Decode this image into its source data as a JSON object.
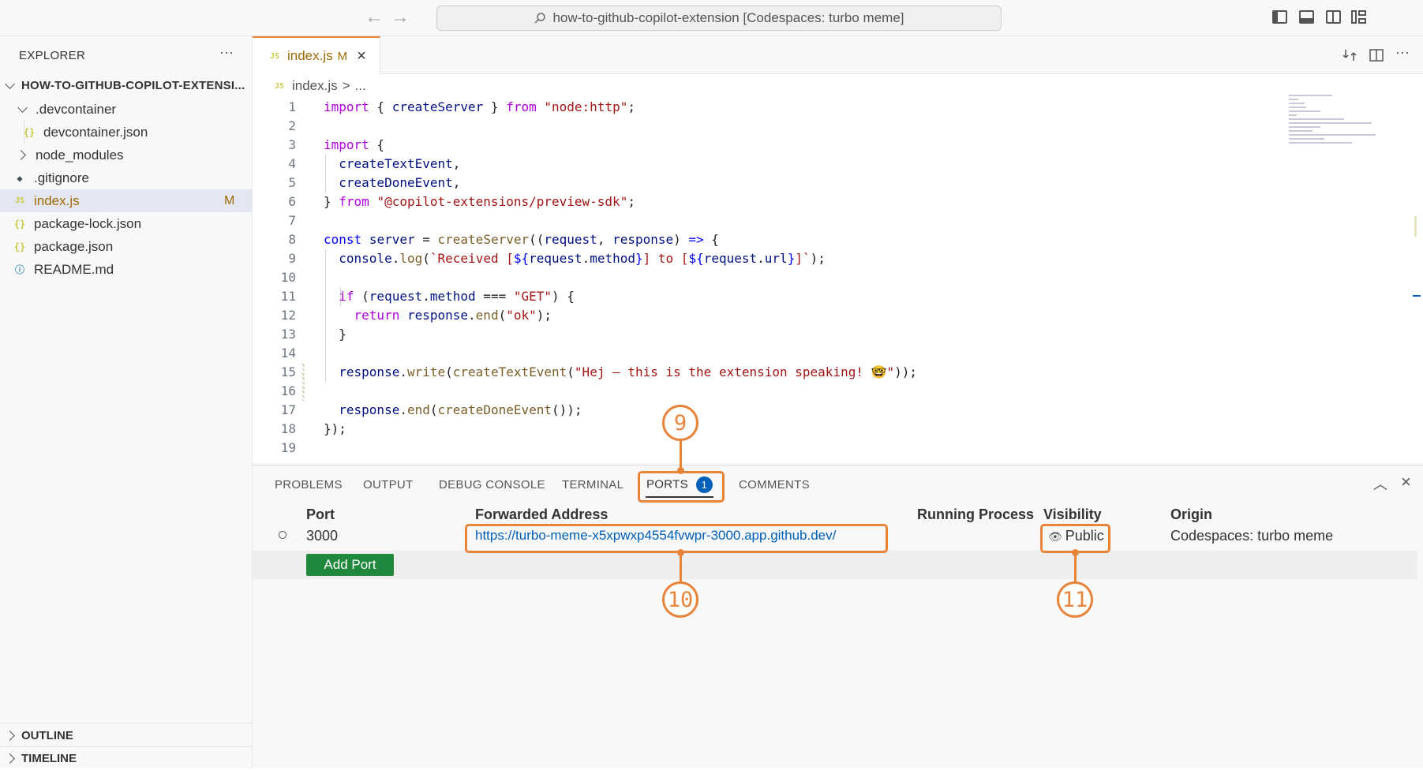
{
  "titlebar": {
    "search_text": "how-to-github-copilot-extension [Codespaces: turbo meme]"
  },
  "sidebar": {
    "title": "EXPLORER",
    "more": "···",
    "root": "HOW-TO-GITHUB-COPILOT-EXTENSI...",
    "items": [
      {
        "label": ".devcontainer",
        "icon": "chevron-down-icon"
      },
      {
        "label": "devcontainer.json",
        "icon": "json-file-icon"
      },
      {
        "label": "node_modules",
        "icon": "chevron-right-icon"
      },
      {
        "label": ".gitignore",
        "icon": "git-file-icon"
      },
      {
        "label": "index.js",
        "icon": "js-file-icon",
        "badge": "M"
      },
      {
        "label": "package-lock.json",
        "icon": "json-file-icon"
      },
      {
        "label": "package.json",
        "icon": "json-file-icon"
      },
      {
        "label": "README.md",
        "icon": "info-file-icon"
      }
    ],
    "outline": "OUTLINE",
    "timeline": "TIMELINE"
  },
  "editor": {
    "tab_label": "index.js",
    "tab_badge": "M",
    "tab_icon": "JS",
    "breadcrumb_file": "index.js",
    "breadcrumb_sep": ">",
    "breadcrumb_more": "...",
    "line_numbers": [
      "1",
      "2",
      "3",
      "4",
      "5",
      "6",
      "7",
      "8",
      "9",
      "10",
      "11",
      "12",
      "13",
      "14",
      "15",
      "16",
      "17",
      "18",
      "19"
    ]
  },
  "panel": {
    "tabs": [
      "PROBLEMS",
      "OUTPUT",
      "DEBUG CONSOLE",
      "TERMINAL",
      "PORTS",
      "COMMENTS"
    ],
    "ports_count": "1",
    "columns": [
      "Port",
      "Forwarded Address",
      "Running Process",
      "Visibility",
      "Origin"
    ],
    "row": {
      "port": "3000",
      "address": "https://turbo-meme-x5xpwxp4554fvwpr-3000.app.github.dev/",
      "running_process": "",
      "visibility": "Public",
      "origin": "Codespaces: turbo meme"
    },
    "add_port_label": "Add Port"
  },
  "annotations": {
    "ports": "9",
    "address": "10",
    "visibility": "11"
  },
  "colors": {
    "accent_orange": "#e8833a",
    "link_blue": "#005fb8",
    "button_green": "#1f883d"
  }
}
